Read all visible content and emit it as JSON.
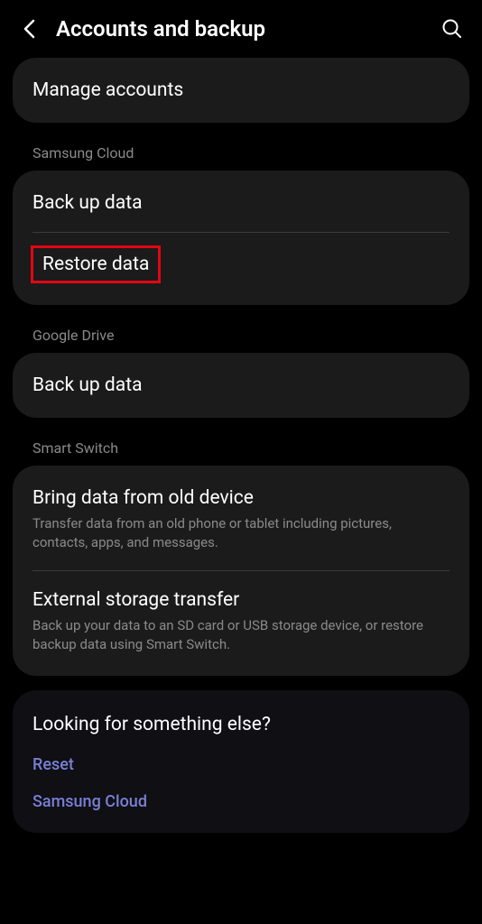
{
  "header": {
    "title": "Accounts and backup"
  },
  "sections": {
    "manage": {
      "title": "Manage accounts"
    },
    "samsung_cloud": {
      "label": "Samsung Cloud",
      "backup": "Back up data",
      "restore": "Restore data"
    },
    "google_drive": {
      "label": "Google Drive",
      "backup": "Back up data"
    },
    "smart_switch": {
      "label": "Smart Switch",
      "bring_data": {
        "title": "Bring data from old device",
        "sub": "Transfer data from an old phone or tablet including pictures, contacts, apps, and messages."
      },
      "external": {
        "title": "External storage transfer",
        "sub": "Back up your data to an SD card or USB storage device, or restore backup data using Smart Switch."
      }
    },
    "footer": {
      "title": "Looking for something else?",
      "reset": "Reset",
      "samsung_cloud": "Samsung Cloud"
    }
  }
}
